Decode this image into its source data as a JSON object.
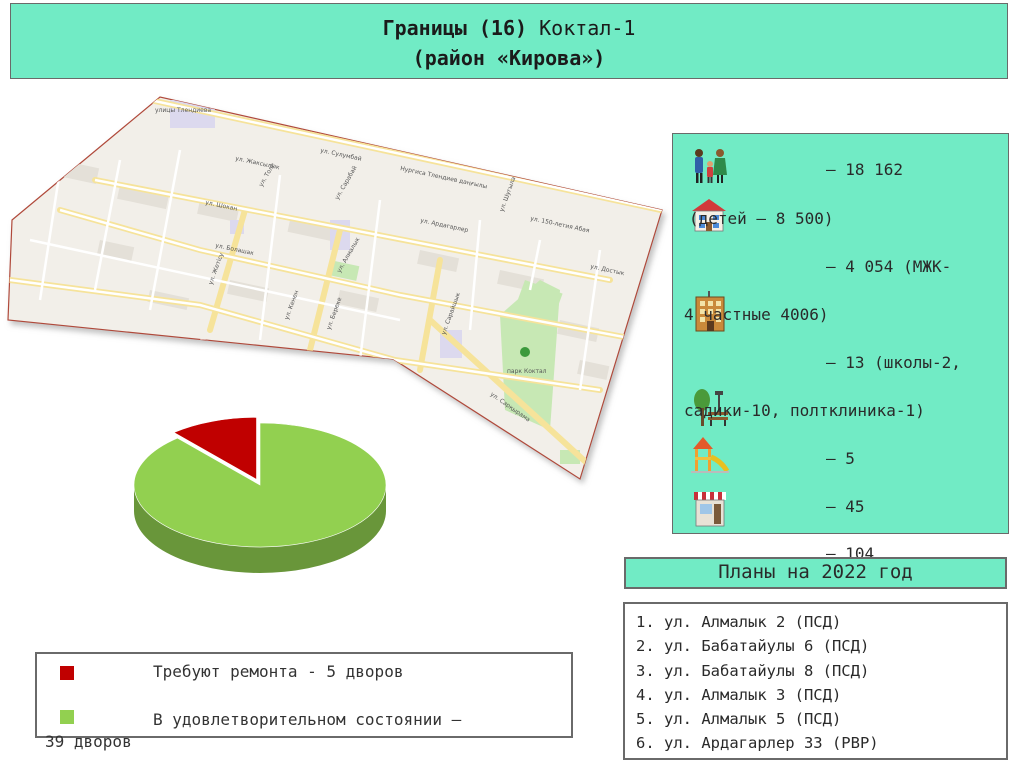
{
  "title": {
    "line1_bold": "Границы (16)",
    "line1_rest": "Коктал-1",
    "line2": "(район «Кирова»)"
  },
  "map": {
    "labels": {
      "top_street": "улицы Тлендиева",
      "nurgisa": "Нургиса Тлендиев даңғылы",
      "sulumbai": "ул. Сулумбай",
      "zhaksy": "ул. Жаксылык",
      "tole": "ул. Толе",
      "saraba": "ул. Сарабай",
      "shokan": "ул. Шокан",
      "ardagarler": "ул. Ардагарлер",
      "shugyla": "ул. Шугыла",
      "s150": "ул. 150-летия Абая",
      "bolashak": "ул. Болашак",
      "zhetisu": "ул. Жетісу",
      "almalyk": "ул. Алмалык",
      "dostyk": "ул. Достык",
      "park": "парк Коктал",
      "saraishyk": "ул. Сарайшык",
      "kenen": "ул. Кенен",
      "bereke": "ул. Береке",
      "sarkyrama": "ул. Сарқырама"
    }
  },
  "stats": [
    {
      "icon": "family-icon",
      "text": "– 18 162"
    },
    {
      "icon": "house-icon",
      "text": "(детей – 8 500)"
    },
    {
      "icon": "",
      "text": "– 4 054 (МЖК-"
    },
    {
      "icon": "apartment-building-icon",
      "text": "4 частные 4006)"
    },
    {
      "icon": "",
      "text": "– 13 (школы-2,"
    },
    {
      "icon": "tree-bench-icon",
      "text": "садики-10, полтклиника-1)"
    },
    {
      "icon": "playground-icon",
      "text": "– 5"
    },
    {
      "icon": "shop-icon",
      "text": "– 45"
    },
    {
      "icon": "",
      "text": "– 104"
    }
  ],
  "plans": {
    "header": "Планы на 2022 год",
    "items": [
      "1. ул. Алмалык 2 (ПСД)",
      "2. ул. Бабатайулы 6 (ПСД)",
      "3. ул. Бабатайулы 8 (ПСД)",
      "4. ул. Алмалык 3 (ПСД)",
      "5. ул. Алмалык 5 (ПСД)",
      "6. ул. Ардагарлер 33 (РВР)"
    ]
  },
  "legend": {
    "repair_text": "Требуют ремонта - 5 дворов",
    "ok_text_line1": "В удовлетворительном состоянии –",
    "ok_text_line2": "39 дворов",
    "repair_color": "#c00000",
    "ok_color": "#92d050"
  },
  "chart_data": {
    "type": "pie",
    "categories": [
      "Требуют ремонта",
      "В удовлетворительном состоянии"
    ],
    "values": [
      5,
      39
    ],
    "colors": [
      "#c00000",
      "#92d050"
    ],
    "title": ""
  }
}
